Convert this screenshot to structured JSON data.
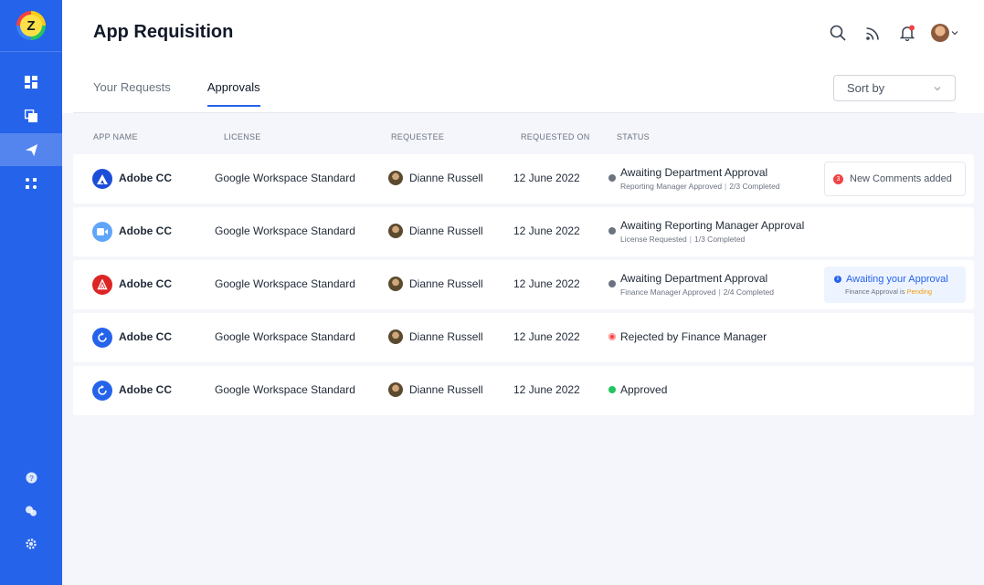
{
  "app": {
    "title": "App Requisition"
  },
  "tabs": [
    {
      "label": "Your Requests"
    },
    {
      "label": "Approvals"
    }
  ],
  "sort": {
    "label": "Sort by"
  },
  "table": {
    "headers": [
      "APP NAME",
      "LICENSE",
      "REQUESTEE",
      "REQUESTED ON",
      "STATUS"
    ],
    "rows": [
      {
        "app": "Adobe CC",
        "icon": "adobe-icon",
        "license": "Google Workspace Standard",
        "requestee": "Dianne Russell",
        "date": "12 June 2022",
        "status": "Awaiting Department Approval",
        "sub1": "Reporting Manager Approved",
        "sub2": "2/3 Completed",
        "extra": "comments",
        "extra_count": "3",
        "extra_label": "New Comments added"
      },
      {
        "app": "Adobe CC",
        "icon": "video-icon",
        "license": "Google Workspace Standard",
        "requestee": "Dianne Russell",
        "date": "12 June 2022",
        "status": "Awaiting Reporting Manager Approval",
        "sub1": "License Requested",
        "sub2": "1/3 Completed"
      },
      {
        "app": "Adobe CC",
        "icon": "acrobat-icon",
        "license": "Google Workspace Standard",
        "requestee": "Dianne Russell",
        "date": "12 June 2022",
        "status": "Awaiting Department Approval",
        "sub1": "Finance Manager Approved",
        "sub2": "2/4 Completed",
        "extra": "awaiting",
        "extra_label": "Awaiting your Approval",
        "extra_sub": "Finance Approval is",
        "extra_state": "Pending"
      },
      {
        "app": "Adobe CC",
        "icon": "refresh-app-icon",
        "license": "Google Workspace Standard",
        "requestee": "Dianne Russell",
        "date": "12 June 2022",
        "status": "Rejected by Finance Manager"
      },
      {
        "app": "Adobe CC",
        "icon": "refresh-app-icon",
        "license": "Google Workspace Standard",
        "requestee": "Dianne Russell",
        "date": "12 June 2022",
        "status": "Approved"
      }
    ]
  },
  "colors": {
    "sidebar": "#2563eb",
    "accent": "#2563eb",
    "rejected": "#ef4444",
    "approved": "#22c55e",
    "pending": "#f59e0b"
  }
}
